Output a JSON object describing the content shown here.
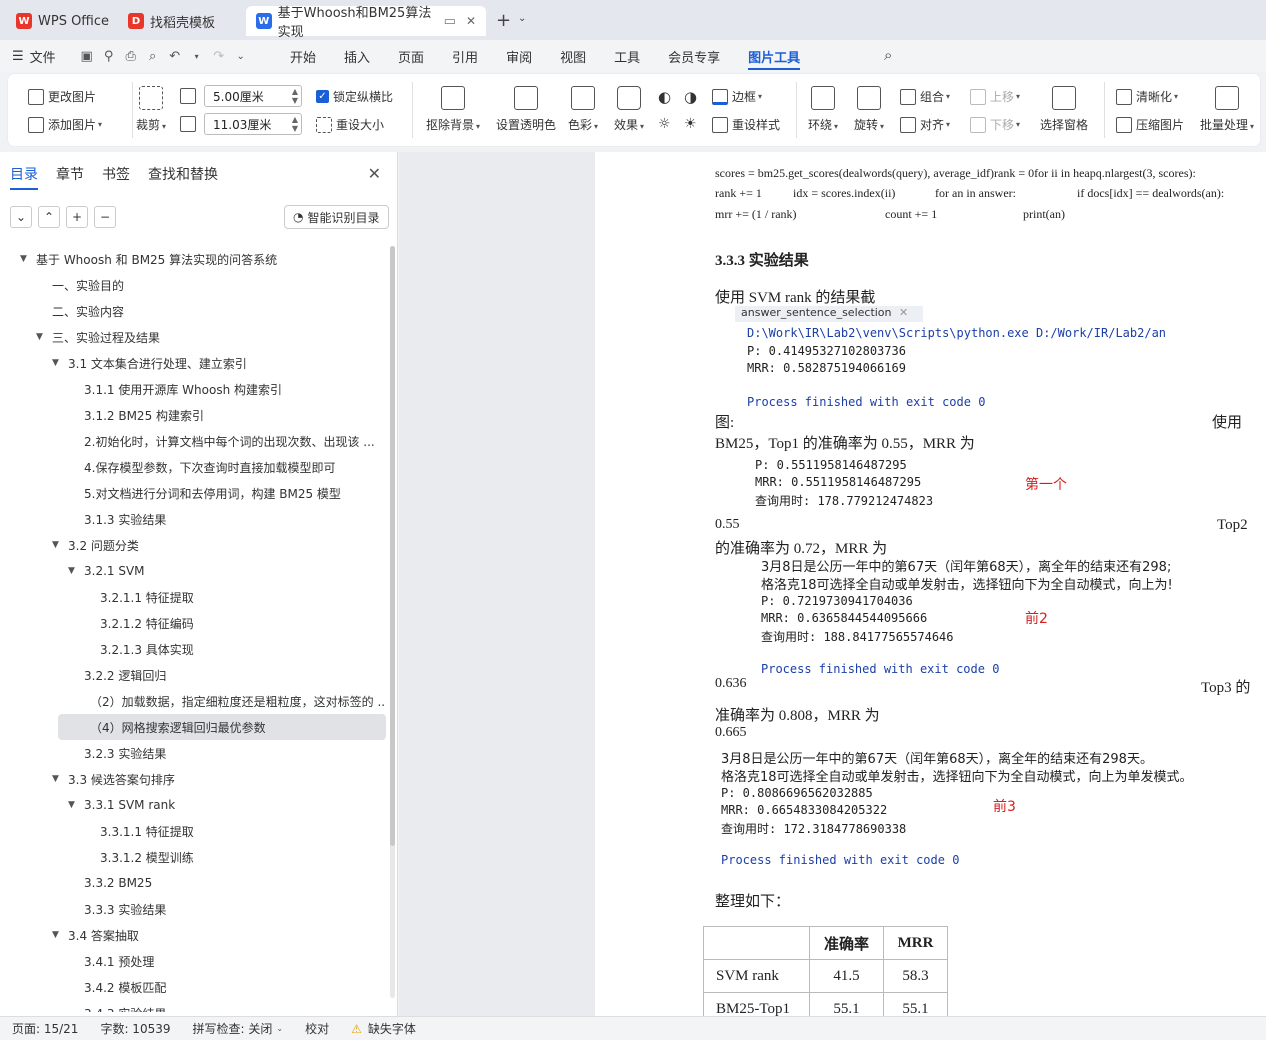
{
  "tabs": [
    {
      "label": "WPS Office",
      "icon": "wps-logo-icon"
    },
    {
      "label": "找稻壳模板",
      "icon": "docer-icon"
    },
    {
      "label": "基于Whoosh和BM25算法实现",
      "icon": "writer-doc-icon"
    }
  ],
  "menubar": {
    "file_label": "文件",
    "tabs": [
      "开始",
      "插入",
      "页面",
      "引用",
      "审阅",
      "视图",
      "工具",
      "会员专享",
      "图片工具"
    ],
    "active_tab": "图片工具"
  },
  "ribbon": {
    "change_image": "更改图片",
    "add_image": "添加图片",
    "crop": "裁剪",
    "width_value": "5.00厘米",
    "height_value": "11.03厘米",
    "lock_ratio": "锁定纵横比",
    "reset_size": "重设大小",
    "remove_bg": "抠除背景",
    "set_transparent": "设置透明色",
    "color": "色彩",
    "effect": "效果",
    "border": "边框",
    "reset_style": "重设样式",
    "wrap": "环绕",
    "rotate": "旋转",
    "group": "组合",
    "align": "对齐",
    "move_up": "上移",
    "move_down": "下移",
    "select_pane": "选择窗格",
    "sharpen": "清晰化",
    "compress": "压缩图片",
    "batch": "批量处理"
  },
  "leftpanel": {
    "tabs": [
      "目录",
      "章节",
      "书签",
      "查找和替换"
    ],
    "active_tab": "目录",
    "smart_toc": "智能识别目录",
    "toc": [
      {
        "text": "基于 Whoosh 和 BM25 算法实现的问答系统",
        "level": 0,
        "expanded": true
      },
      {
        "text": "一、实验目的",
        "level": 1
      },
      {
        "text": "二、实验内容",
        "level": 1
      },
      {
        "text": "三、实验过程及结果",
        "level": 1,
        "expanded": true
      },
      {
        "text": "3.1  文本集合进行处理、建立索引",
        "level": 2,
        "expanded": true
      },
      {
        "text": "3.1.1 使用开源库 Whoosh 构建索引",
        "level": 3
      },
      {
        "text": "3.1.2 BM25 构建索引",
        "level": 3
      },
      {
        "text": "2.初始化时，计算文档中每个词的出现次数、出现该 ...",
        "level": 3
      },
      {
        "text": "4.保存模型参数，下次查询时直接加载模型即可",
        "level": 3
      },
      {
        "text": "5.对文档进行分词和去停用词，构建 BM25 模型",
        "level": 3
      },
      {
        "text": "3.1.3  实验结果",
        "level": 3
      },
      {
        "text": "3.2 问题分类",
        "level": 2,
        "expanded": true
      },
      {
        "text": "3.2.1 SVM",
        "level": 3,
        "expanded": true
      },
      {
        "text": "3.2.1.1  特征提取",
        "level": 4
      },
      {
        "text": "3.2.1.2  特征编码",
        "level": 4
      },
      {
        "text": "3.2.1.3  具体实现",
        "level": 4
      },
      {
        "text": "3.2.2  逻辑回归",
        "level": 3
      },
      {
        "text": "（2）加载数据，指定细粒度还是粗粒度，这对标签的 ...",
        "level": 3.4
      },
      {
        "text": "（4）网格搜索逻辑回归最优参数",
        "level": 3.4,
        "selected": true
      },
      {
        "text": "3.2.3 实验结果",
        "level": 3
      },
      {
        "text": "3.3  候选答案句排序",
        "level": 2,
        "expanded": true
      },
      {
        "text": "3.3.1 SVM rank",
        "level": 3,
        "expanded": true
      },
      {
        "text": "3.3.1.1  特征提取",
        "level": 4
      },
      {
        "text": "3.3.1.2  模型训练",
        "level": 4
      },
      {
        "text": "3.3.2 BM25",
        "level": 3
      },
      {
        "text": "3.3.3  实验结果",
        "level": 3
      },
      {
        "text": "3.4  答案抽取",
        "level": 2,
        "expanded": true
      },
      {
        "text": "3.4.1 预处理",
        "level": 3
      },
      {
        "text": "3.4.2 模板匹配",
        "level": 3
      },
      {
        "text": "3.4.3 实验结果",
        "level": 3
      }
    ]
  },
  "doc": {
    "code_line1": "scores = bm25.get_scores(dealwords(query), average_idf)rank = 0for ii in heapq.nlargest(3, scores):",
    "code_line2a": "rank += 1",
    "code_line2b": "idx = scores.index(ii)",
    "code_line2c": "for an in answer:",
    "code_line2d": "if docs[idx] == dealwords(an):",
    "code_line3a": "mrr += (1 / rank)",
    "code_line3b": "count += 1",
    "code_line3c": "print(an)",
    "heading": "3.3.3  实验结果",
    "svm_caption": "使用 SVM rank 的结果截",
    "shot1": {
      "tab_label": "answer_sentence_selection",
      "cmd": "D:\\Work\\IR\\Lab2\\venv\\Scripts\\python.exe D:/Work/IR/Lab2/an",
      "p": "P:  0.41495327102803736",
      "mrr": "MRR:  0.582875194066169",
      "finish": "Process finished with exit code 0"
    },
    "fig_label": "图:",
    "use_label": "使用",
    "bm25_top1": "BM25，Top1 的准确率为 0.55，MRR 为",
    "shot2": {
      "p": "P:  0.5511958146487295",
      "mrr": "MRR:  0.5511958146487295",
      "time": "查询用时:   178.779212474823",
      "note": "第一个"
    },
    "val_055": "0.55",
    "top2_label": "Top2",
    "top2_text": "的准确率为 0.72，MRR 为",
    "shot3": {
      "line1": "3月8日是公历一年中的第67天（闰年第68天），离全年的结束还有298;",
      "line2": "格洛克18可选择全自动或单发射击，选择钮向下为全自动模式，向上为!",
      "p": "P:  0.7219730941704036",
      "mrr": "MRR:  0.6365844544095666",
      "time": "查询用时:   188.84177565574646",
      "finish": "Process finished with exit code 0",
      "note": "前2"
    },
    "val_0636": "0.636",
    "top3_label": "Top3 的",
    "top3_text": "准确率为 0.808，MRR 为",
    "val_0665": "0.665",
    "shot4": {
      "line1": "3月8日是公历一年中的第67天（闰年第68天），离全年的结束还有298天。",
      "line2": "格洛克18可选择全自动或单发射击，选择钮向下为全自动模式，向上为单发模式。",
      "p": "P:  0.8086696562032885",
      "mrr": "MRR:  0.6654833084205322",
      "time": "查询用时:   172.3184778690338",
      "finish": "Process finished with exit code 0",
      "note": "前3"
    },
    "summary": "整理如下：",
    "table": {
      "headers": [
        "",
        "准确率",
        "MRR"
      ],
      "rows": [
        [
          "SVM rank",
          "41.5",
          "58.3"
        ],
        [
          "BM25-Top1",
          "55.1",
          "55.1"
        ]
      ]
    }
  },
  "statusbar": {
    "page": "页面: 15/21",
    "words": "字数: 10539",
    "spell": "拼写检查: 关闭",
    "proof": "校对",
    "missing_font": "缺失字体"
  },
  "colors": {
    "accent": "#1a5fd6",
    "code_blue": "#1b3fa8",
    "note_red": "#d62020"
  }
}
